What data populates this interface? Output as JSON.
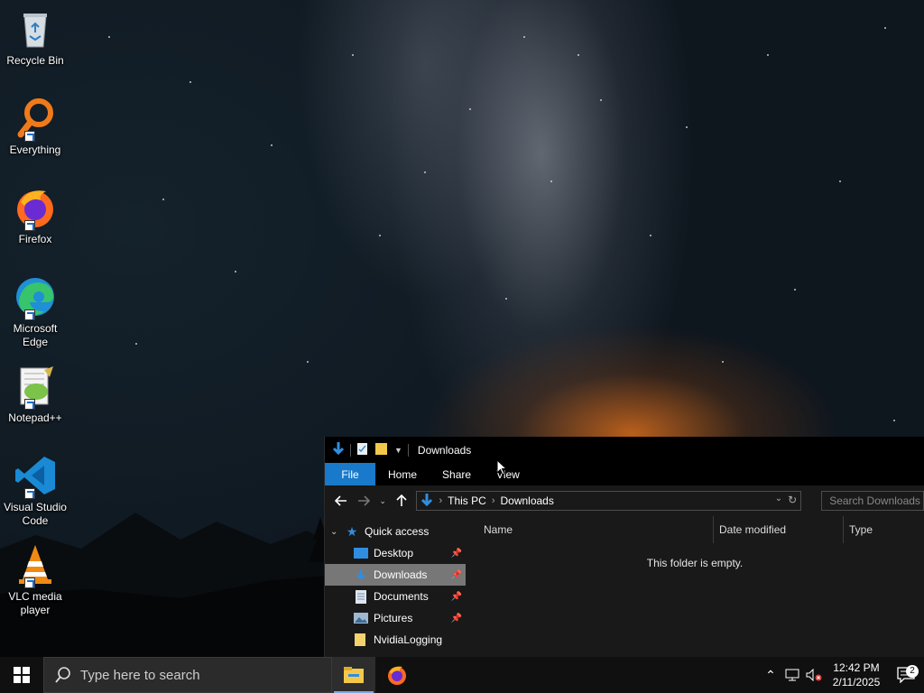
{
  "desktop": {
    "icons": [
      {
        "label": "Recycle Bin"
      },
      {
        "label": "Everything"
      },
      {
        "label": "Firefox"
      },
      {
        "label": "Microsoft Edge"
      },
      {
        "label": "Notepad++"
      },
      {
        "label": "Visual Studio Code"
      },
      {
        "label": "VLC media player"
      }
    ]
  },
  "explorer": {
    "title": "Downloads",
    "ribbon_tabs": [
      "File",
      "Home",
      "Share",
      "View"
    ],
    "address": {
      "crumbs": [
        "This PC",
        "Downloads"
      ]
    },
    "search_placeholder": "Search Downloads",
    "nav_pane": [
      {
        "label": "Quick access"
      },
      {
        "label": "Desktop"
      },
      {
        "label": "Downloads"
      },
      {
        "label": "Documents"
      },
      {
        "label": "Pictures"
      },
      {
        "label": "NvidiaLogging"
      }
    ],
    "columns": [
      "Name",
      "Date modified",
      "Type"
    ],
    "empty_message": "This folder is empty."
  },
  "taskbar": {
    "search_placeholder": "Type here to search",
    "clock_time": "12:42 PM",
    "clock_date": "2/11/2025",
    "notification_count": "2"
  }
}
